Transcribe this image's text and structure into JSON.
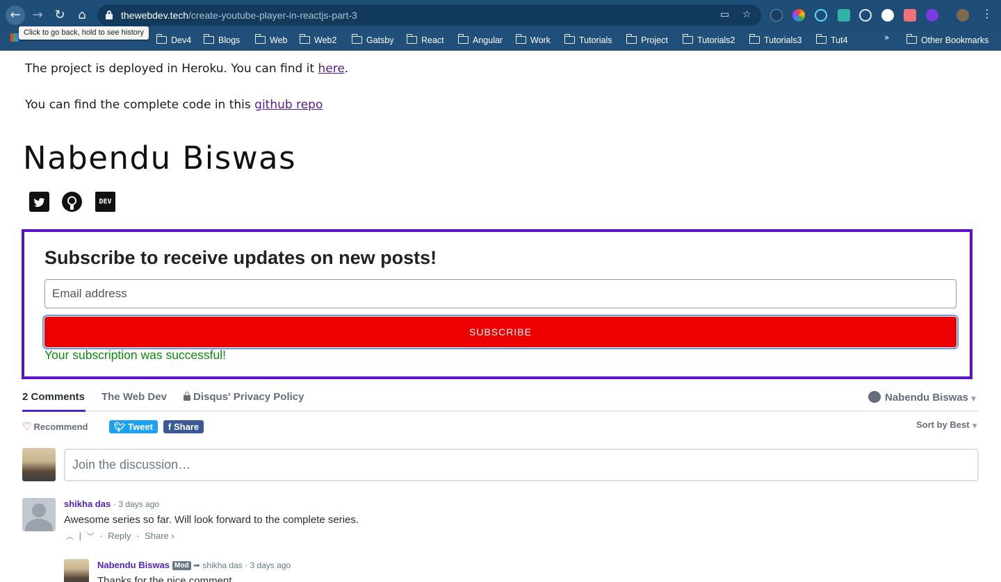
{
  "browser": {
    "url_host": "thewebdev.tech",
    "url_path": "/create-youtube-player-in-reactjs-part-3",
    "tooltip": "Click to go back, hold to see history",
    "bookmarks": [
      "Dev4",
      "Blogs",
      "Web",
      "Web2",
      "Gatsby",
      "React",
      "Angular",
      "Work",
      "Tutorials",
      "Project",
      "Tutorials2",
      "Tutorials3",
      "Tut4"
    ],
    "other_bookmarks": "Other Bookmarks",
    "more": "»"
  },
  "article": {
    "deploy_text": "The project is deployed in Heroku. You can find it ",
    "deploy_link": "here",
    "deploy_end": ".",
    "code_text": "You can find the complete code in this ",
    "code_link": "github repo"
  },
  "author": {
    "name": "Nabendu Biswas",
    "social": [
      "twitter-icon",
      "github-icon",
      "dev-icon"
    ],
    "dev_label": "DEV"
  },
  "subscribe": {
    "title": "Subscribe to receive updates on new posts!",
    "email_placeholder": "Email address",
    "button_label": "SUBSCRIBE",
    "success": "Your subscription was successful!",
    "border_color": "#5a0fc8",
    "button_color": "#ee0000"
  },
  "disqus": {
    "tabs": [
      "2 Comments",
      "The Web Dev",
      "Disqus' Privacy Policy"
    ],
    "user": "Nabendu Biswas",
    "recommend": "Recommend",
    "tweet": "Tweet",
    "share": "Share",
    "sort": "Sort by Best",
    "join_placeholder": "Join the discussion…",
    "accent": "#4e23c8",
    "comments": [
      {
        "author": "shikha das",
        "time": "· 3 days ago",
        "body": "Awesome series so far. Will look forward to the complete series.",
        "reply": "Reply",
        "share": "Share ›"
      }
    ],
    "reply": {
      "author": "Nabendu Biswas",
      "badge": "Mod",
      "to": "shikha das",
      "time": "· 3 days ago",
      "body": "Thanks for the nice comment"
    }
  }
}
